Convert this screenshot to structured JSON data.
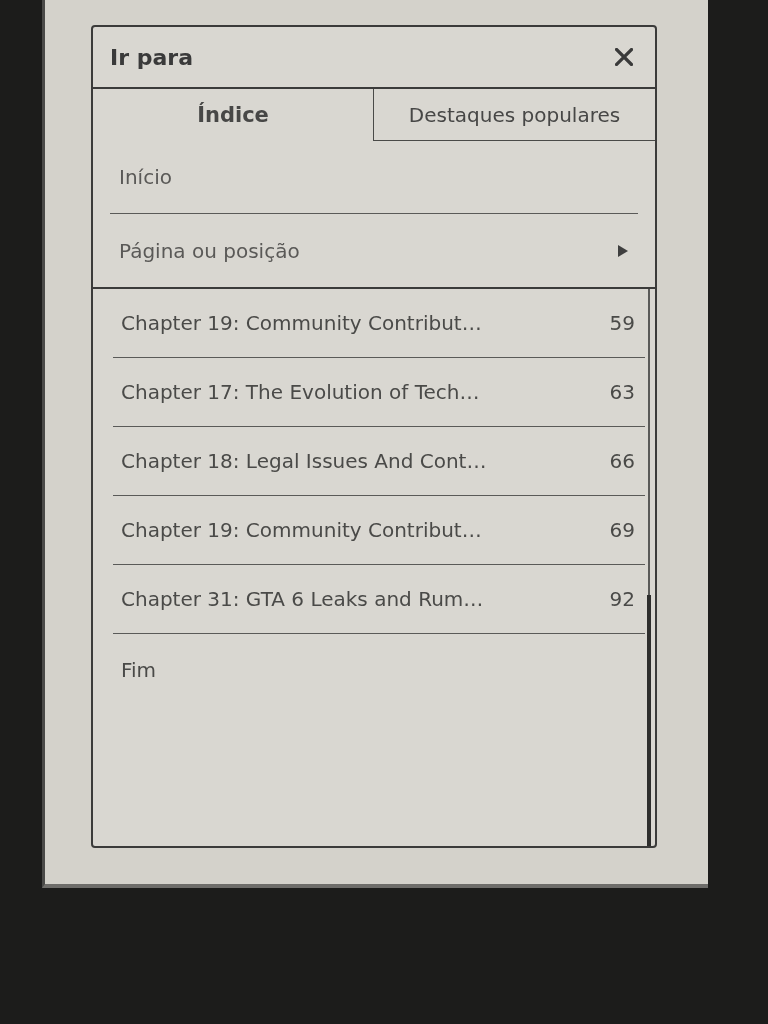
{
  "dialog": {
    "title": "Ir para"
  },
  "tabs": [
    {
      "label": "Índice",
      "selected": true
    },
    {
      "label": "Destaques populares",
      "selected": false
    }
  ],
  "menu_items": [
    {
      "label": "Início",
      "kind": "plain"
    },
    {
      "label": "Página ou posição",
      "kind": "submenu"
    }
  ],
  "contents": [
    {
      "title": "Chapter 19: Community Contribut…",
      "page": "59"
    },
    {
      "title": "Chapter 17: The Evolution of Tech…",
      "page": "63"
    },
    {
      "title": "Chapter 18: Legal Issues And Cont…",
      "page": "66"
    },
    {
      "title": "Chapter 19: Community Contribut…",
      "page": "69"
    },
    {
      "title": "Chapter 31: GTA 6 Leaks and Rum…",
      "page": "92"
    },
    {
      "title": "Fim"
    }
  ]
}
